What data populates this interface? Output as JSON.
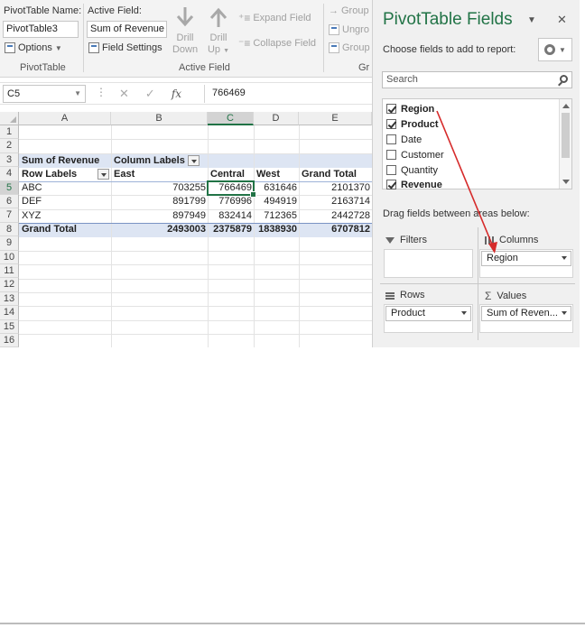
{
  "ribbon": {
    "pivot_name_label": "PivotTable Name:",
    "pivot_name_value": "PivotTable3",
    "options_label": "Options",
    "pivottable_group": "PivotTable",
    "active_field_label": "Active Field:",
    "active_field_value": "Sum of Revenue",
    "field_settings_label": "Field Settings",
    "drill_down_1": "Drill",
    "drill_down_2": "Down",
    "drill_up_1": "Drill",
    "drill_up_2": "Up",
    "expand_field": "Expand Field",
    "collapse_field": "Collapse Field",
    "active_field_group": "Active Field",
    "group_label": "Group",
    "ungroup_label": "Ungro",
    "group2_label": "Group",
    "group_group": "Gr"
  },
  "formula_bar": {
    "name_box": "C5",
    "fx": "fx",
    "value": "766469"
  },
  "grid": {
    "columns": [
      "A",
      "B",
      "C",
      "D",
      "E"
    ],
    "rows": [
      "1",
      "2",
      "3",
      "4",
      "5",
      "6",
      "7",
      "8",
      "9",
      "10",
      "11",
      "12",
      "13",
      "14",
      "15",
      "16"
    ],
    "sum_label": "Sum of Revenue",
    "col_labels": "Column Labels",
    "row_labels": "Row Labels",
    "headers": [
      "East",
      "Central",
      "West",
      "Grand Total"
    ],
    "data": [
      {
        "label": "ABC",
        "values": [
          "703255",
          "766469",
          "631646",
          "2101370"
        ]
      },
      {
        "label": "DEF",
        "values": [
          "891799",
          "776996",
          "494919",
          "2163714"
        ]
      },
      {
        "label": "XYZ",
        "values": [
          "897949",
          "832414",
          "712365",
          "2442728"
        ]
      }
    ],
    "total": {
      "label": "Grand Total",
      "values": [
        "2493003",
        "2375879",
        "1838930",
        "6707812"
      ]
    }
  },
  "pane": {
    "title": "PivotTable Fields",
    "subtitle": "Choose fields to add to report:",
    "search_placeholder": "Search",
    "fields": [
      {
        "name": "Region",
        "checked": true
      },
      {
        "name": "Product",
        "checked": true
      },
      {
        "name": "Date",
        "checked": false
      },
      {
        "name": "Customer",
        "checked": false
      },
      {
        "name": "Quantity",
        "checked": false
      },
      {
        "name": "Revenue",
        "checked": true
      }
    ],
    "drag_label": "Drag fields between areas below:",
    "filters_label": "Filters",
    "columns_label": "Columns",
    "rows_label": "Rows",
    "values_label": "Values",
    "columns_item": "Region",
    "rows_item": "Product",
    "values_item": "Sum of Reven..."
  },
  "colors": {
    "accent": "#217346",
    "pivot_band": "#dde5f3",
    "annotation_arrow": "#d62b2b"
  }
}
